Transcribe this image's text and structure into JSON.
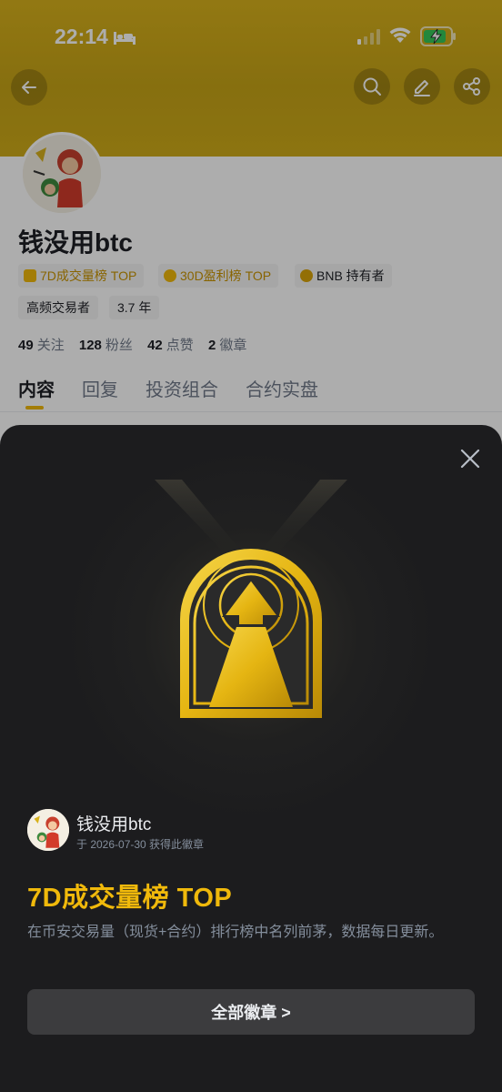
{
  "status_bar": {
    "time": "22:14"
  },
  "profile": {
    "username": "钱没用btc",
    "tags": [
      {
        "label": "7D成交量榜 TOP",
        "style": "gold"
      },
      {
        "label": "30D盈利榜 TOP",
        "style": "gold"
      },
      {
        "label": "BNB 持有者",
        "style": "dark"
      },
      {
        "label": "高频交易者",
        "style": "dark"
      },
      {
        "label": "3.7 年",
        "style": "dark"
      }
    ],
    "stats": [
      {
        "value": "49",
        "label": "关注"
      },
      {
        "value": "128",
        "label": "粉丝"
      },
      {
        "value": "42",
        "label": "点赞"
      },
      {
        "value": "2",
        "label": "徽章"
      }
    ],
    "tabs": [
      "内容",
      "回复",
      "投资组合",
      "合约实盘"
    ],
    "active_tab": "内容"
  },
  "badge_sheet": {
    "owner_name": "钱没用btc",
    "obtained_text": "于 2026-07-30 获得此徽章",
    "title": "7D成交量榜 TOP",
    "description": "在币安交易量（现货+合约）排行榜中名列前茅，数据每日更新。",
    "all_badges_label": "全部徽章 >"
  },
  "colors": {
    "accent": "#F0B90B",
    "sheet_bg": "#1C1C1E",
    "header_bg": "#D8B21C"
  },
  "icons": [
    "back-arrow-icon",
    "search-icon",
    "edit-icon",
    "share-icon",
    "close-icon",
    "badge-arrow-icon"
  ]
}
